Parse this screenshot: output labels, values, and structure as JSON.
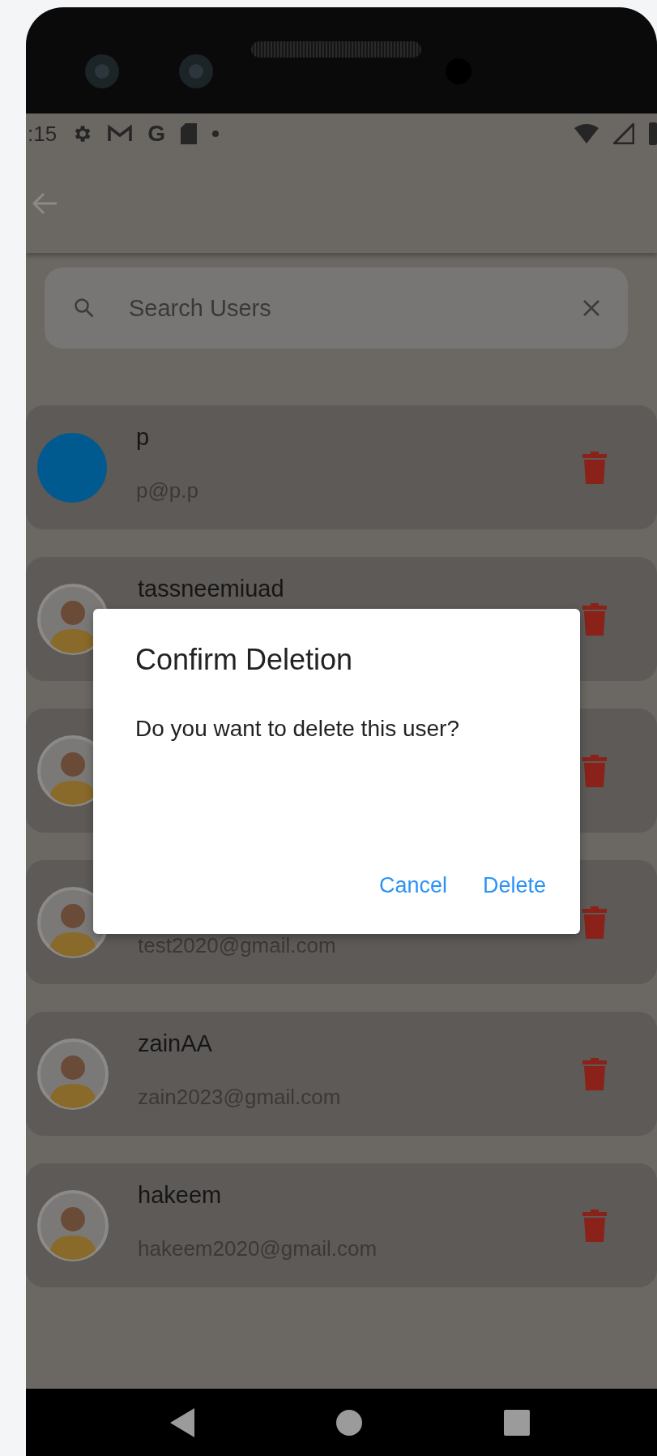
{
  "status_bar": {
    "time": ":15",
    "glyph": "G"
  },
  "search": {
    "placeholder": "Search Users"
  },
  "users": [
    {
      "kind": "circle",
      "name": "p",
      "email": "p@p.p"
    },
    {
      "kind": "silhouette",
      "name": "tassneemiuad"
    },
    {
      "kind": "silhouette"
    },
    {
      "kind": "silhouette",
      "email": "test2020@gmail.com"
    },
    {
      "kind": "silhouette",
      "name": "zainAA",
      "email": "zain2023@gmail.com"
    },
    {
      "kind": "silhouette",
      "name": "hakeem",
      "email": "hakeem2020@gmail.com"
    }
  ],
  "dialog": {
    "title": "Confirm Deletion",
    "message": "Do you want to delete this user?",
    "buttons": [
      "Cancel",
      "Delete"
    ]
  }
}
